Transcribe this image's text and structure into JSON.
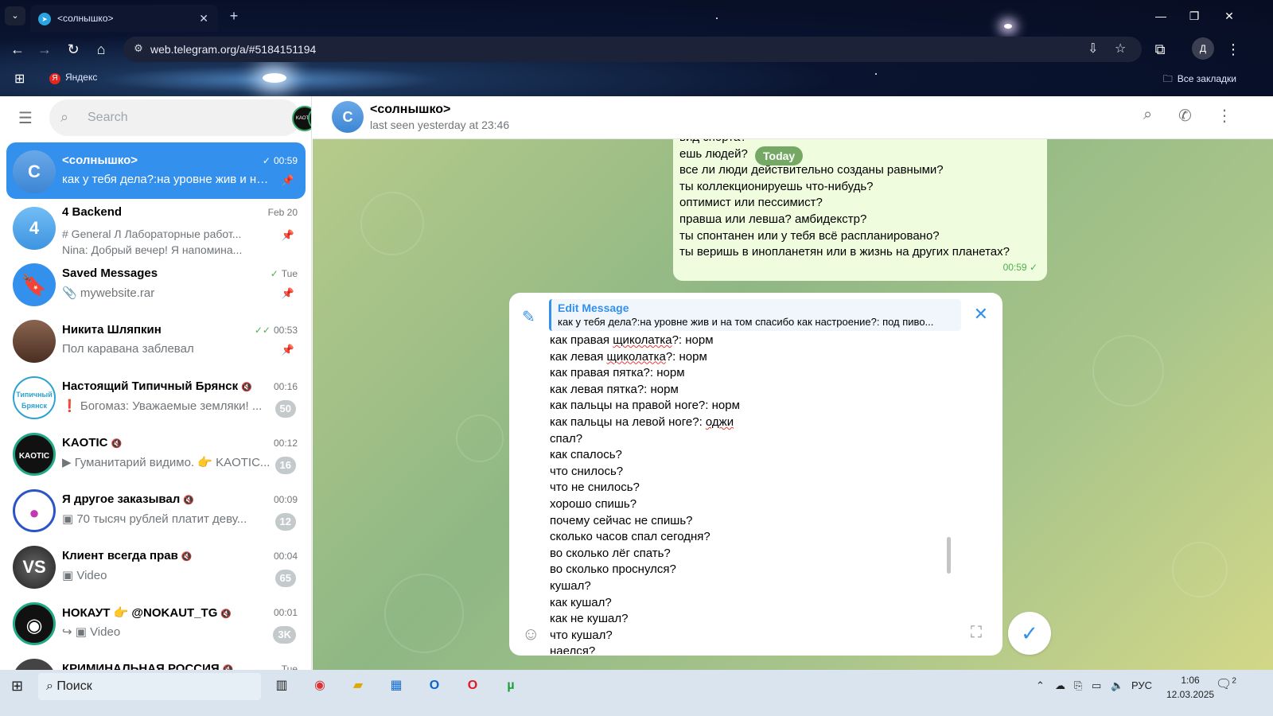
{
  "browser": {
    "tab_title": "<солнышко>",
    "url": "web.telegram.org/a/#5184151194",
    "bookmark_yandex": "Яндекс",
    "bookmark_all": "Все закладки",
    "profile_initial": "Д"
  },
  "sidebar": {
    "search_placeholder": "Search",
    "chats": [
      {
        "name": "<солнышко>",
        "avatar_letter": "С",
        "avatar_color": "#5b9bd5",
        "time": "00:59",
        "preview": "как у тебя дела?:на уровне жив и на том спасибо",
        "pinned": true
      },
      {
        "name": "4 Backend",
        "avatar_letter": "4",
        "avatar_color": "#5caff0",
        "time": "Feb 20",
        "preview": "# General Л Лабораторные работ...",
        "preview2": "Nina: Добрый вечер! Я напомина...",
        "pinned": true
      },
      {
        "name": "Saved Messages",
        "avatar_color": "#3390ec",
        "time": "Tue",
        "preview": "mywebsite.rar",
        "pinned": true
      },
      {
        "name": "Никита Шляпкин",
        "avatar_color": "#6b4a3a",
        "time": "00:53",
        "preview": "Пол каравана заблевал",
        "pinned": true
      },
      {
        "name": "Настоящий Типичный Брянск",
        "avatar_color": "#2aa3d0",
        "time": "00:16",
        "preview": "❗ Богомаз: Уважаемые земляки! ...",
        "badge": "50"
      },
      {
        "name": "KAOTIC",
        "avatar_color": "#111111",
        "time": "00:12",
        "preview": "Гуманитарий видимо. 👉 KAOTIC...",
        "badge": "16"
      },
      {
        "name": "Я другое заказывал",
        "avatar_color": "#2a55c9",
        "time": "00:09",
        "preview": "70 тысяч рублей платит деву...",
        "badge": "12"
      },
      {
        "name": "Клиент всегда прав",
        "avatar_color": "#333333",
        "time": "00:04",
        "preview": "Video",
        "badge": "65"
      },
      {
        "name": "НОКАУТ 👉 @NOKAUT_TG",
        "avatar_color": "#111111",
        "time": "00:01",
        "preview": "Video",
        "badge": "3K"
      },
      {
        "name": "КРИМИНАЛЬНАЯ РОССИЯ",
        "avatar_color": "#444444",
        "time": "Tue",
        "preview": ""
      }
    ]
  },
  "header": {
    "title": "<солнышко>",
    "avatar_letter": "С",
    "status": "last seen yesterday at 23:46"
  },
  "bubble": {
    "lines": [
      "вид спорта?",
      "ешь людей?",
      "все ли люди действительно созданы равными?",
      "ты коллекционируешь что-нибудь?",
      "оптимист или пессимист?",
      "правша или левша? амбидекстр?",
      "ты спонтанен или у тебя всё распланировано?",
      "ты веришь в инопланетян или в жизнь на других планетах?"
    ],
    "time": "00:59",
    "date_badge": "Today"
  },
  "composer": {
    "edit_title": "Edit Message",
    "edit_preview": "как у тебя дела?:на уровне жив и на том спасибо как настроение?: под пиво...",
    "lines": [
      "как правая щиколатка?: норм",
      "как левая щиколатка?: норм",
      "как правая пятка?: норм",
      "как левая пятка?: норм",
      "как пальцы на правой ноге?: норм",
      "как пальцы на левой ноге?: оджи",
      "спал?",
      "как спалось?",
      "что снилось?",
      "что не снилось?",
      "хорошо спишь?",
      "почему сейчас не спишь?",
      "сколько часов спал сегодня?",
      "во сколько лёг спать?",
      "во сколько проснулся?",
      "кушал?",
      "как кушал?",
      "как не кушал?",
      "что кушал?",
      "наелся?"
    ]
  },
  "taskbar": {
    "search_label": "Поиск",
    "lang": "РУС",
    "time": "1:06",
    "date": "12.03.2025",
    "notif_count": "2"
  }
}
